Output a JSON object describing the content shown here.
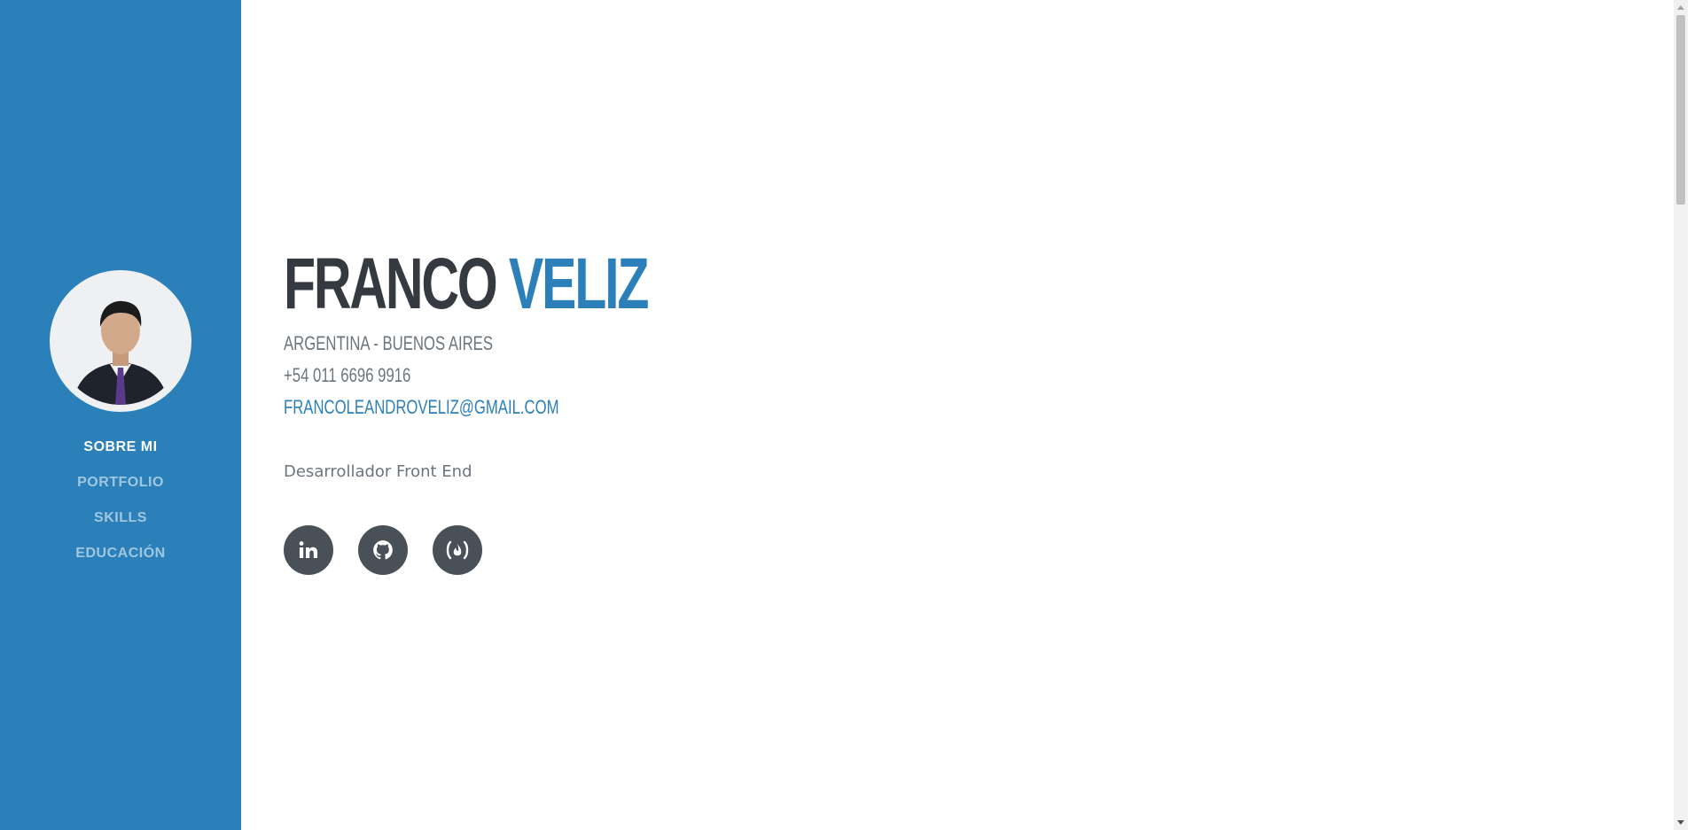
{
  "profile": {
    "first_name": "FRANCO",
    "last_name": "VELIZ",
    "location": "ARGENTINA - BUENOS AIRES",
    "phone": "+54 011 6696 9916",
    "email": "FRANCOLEANDROVELIZ@GMAIL.COM",
    "tagline": "Desarrollador Front End"
  },
  "nav": {
    "items": [
      {
        "label": "SOBRE MI",
        "active": true
      },
      {
        "label": "PORTFOLIO",
        "active": false
      },
      {
        "label": "SKILLS",
        "active": false
      },
      {
        "label": "EDUCACIÓN",
        "active": false
      }
    ]
  },
  "socials": [
    {
      "icon": "linkedin-icon"
    },
    {
      "icon": "github-icon"
    },
    {
      "icon": "freecodecamp-icon"
    }
  ],
  "colors": {
    "primary": "#2c80b9",
    "dark": "#343a40",
    "muted": "#6c757d",
    "social_bg": "#495057"
  }
}
